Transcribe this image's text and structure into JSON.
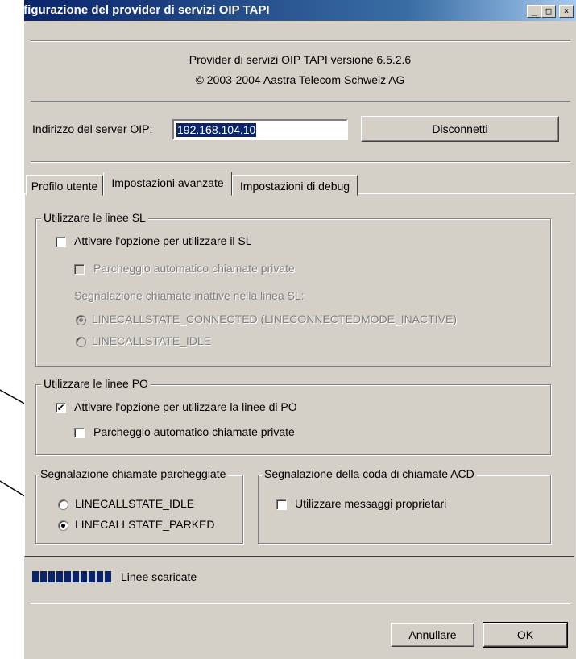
{
  "window": {
    "title": "Configurazione del provider di servizi OIP TAPI",
    "controls": [
      "_",
      "□",
      "×"
    ]
  },
  "header": {
    "line1": "Provider di servizi OIP TAPI versione 6.5.2.6",
    "line2": "© 2003-2004 Aastra Telecom Schweiz AG"
  },
  "server": {
    "label": "Indirizzo del server OIP:",
    "value": "192.168.104.10",
    "disconnect_label": "Disconnetti"
  },
  "tabs": [
    {
      "label": "Profilo utente",
      "active": false
    },
    {
      "label": "Impostazioni avanzate",
      "active": true
    },
    {
      "label": "Impostazioni di debug",
      "active": false
    }
  ],
  "sl_group": {
    "title": "Utilizzare le linee SL",
    "enable_label": "Attivare l'opzione per utilizzare il SL",
    "enable_checked": false,
    "park_label": "Parcheggio automatico chiamate private",
    "signal_label": "Segnalazione chiamate inattive nella linea SL:",
    "radio_connected": "LINECALLSTATE_CONNECTED (LINECONNECTEDMODE_INACTIVE)",
    "radio_idle": "LINECALLSTATE_IDLE",
    "selected": "connected"
  },
  "po_group": {
    "title": "Utilizzare le linee PO",
    "enable_label": "Attivare l'opzione per utilizzare la linee di PO",
    "enable_checked": true,
    "park_label": "Parcheggio automatico chiamate private",
    "park_checked": false
  },
  "parked_group": {
    "title": "Segnalazione chiamate parcheggiate",
    "radio_idle": "LINECALLSTATE_IDLE",
    "radio_parked": "LINECALLSTATE_PARKED",
    "selected": "parked"
  },
  "acd_group": {
    "title": "Segnalazione della coda di chiamate ACD",
    "proprietary_label": "Utilizzare messaggi proprietari",
    "proprietary_checked": false
  },
  "status": {
    "progress_label": "Linee scaricate",
    "progress": 1.0
  },
  "footer": {
    "cancel_label": "Annullare",
    "ok_label": "OK"
  },
  "colors": {
    "titlebar": "#0a246a",
    "face": "#d4d0c8",
    "selection": "#0a246a"
  }
}
